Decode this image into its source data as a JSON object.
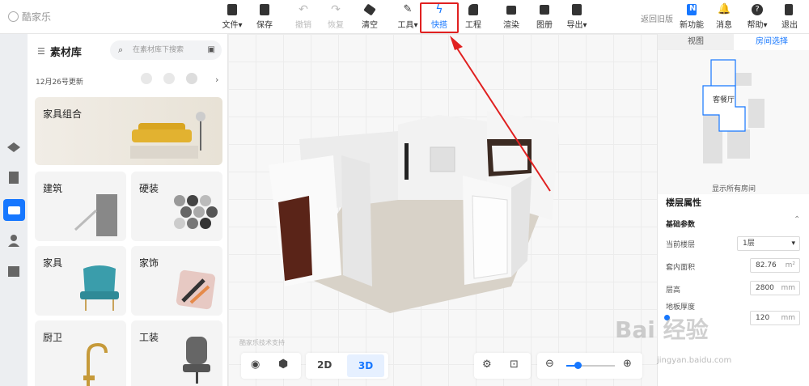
{
  "app": {
    "logo_text": "酷家乐"
  },
  "toolbar": {
    "file": "文件",
    "save": "保存",
    "undo": "撤销",
    "redo": "恢复",
    "clear": "清空",
    "tools": "工具",
    "quick": "快搭",
    "engineering": "工程",
    "render": "渲染",
    "album": "图册",
    "export": "导出",
    "old_version": "返回旧版",
    "new_features": "新功能",
    "messages": "消息",
    "help": "帮助",
    "exit": "退出"
  },
  "materials": {
    "title": "素材库",
    "search_placeholder": "在素材库下搜索",
    "update_note": "12月26号更新",
    "cards": {
      "furniture_combo": "家具组合",
      "building": "建筑",
      "hard_decor": "硬装",
      "furniture": "家具",
      "soft_decor": "家饰",
      "kitchen_bath": "厨卫",
      "tooling": "工装"
    }
  },
  "viewport": {
    "view_2d": "2D",
    "view_3d": "3D",
    "tech_support": "酷家乐技术支持"
  },
  "right_panel": {
    "tab_view": "视图",
    "tab_room_select": "房间选择",
    "room_label": "客餐厅",
    "show_all_rooms": "显示所有房间",
    "floor_props": "楼层属性",
    "basic_params": "基础参数",
    "current_floor_label": "当前楼层",
    "current_floor_value": "1层",
    "inner_area_label": "套内面积",
    "inner_area_value": "82.76",
    "inner_area_unit": "m²",
    "floor_height_label": "层高",
    "floor_height_value": "2800",
    "floor_height_unit": "mm",
    "floor_thickness_label": "地板厚度",
    "floor_thickness_value": "120",
    "floor_thickness_unit": "mm"
  },
  "watermark": {
    "main": "Bai 经验",
    "sub": "jingyan.baidu.com"
  },
  "colors": {
    "accent": "#1677ff",
    "highlight_box": "#e02020"
  }
}
